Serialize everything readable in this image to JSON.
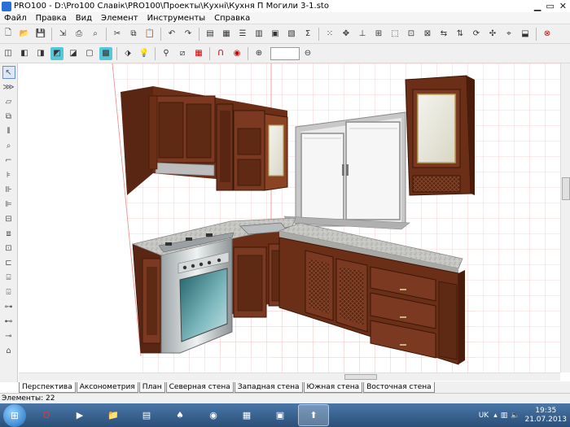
{
  "titlebar": {
    "title": "PRO100 - D:\\Pro100 Славік\\PRO100\\Проекты\\Кухні\\Кухня П Могили 3-1.sto",
    "minimize_icon": "minimize-icon",
    "maximize_icon": "maximize-icon",
    "close_icon": "close-icon"
  },
  "menu": {
    "file": "Файл",
    "edit": "Правка",
    "view": "Вид",
    "element": "Элемент",
    "tools": "Инструменты",
    "help": "Справка"
  },
  "toolbar_icons": [
    "new-icon",
    "open-icon",
    "save-icon",
    "export-icon",
    "print-icon",
    "print-preview-icon",
    "cut-icon",
    "copy-icon",
    "paste-icon",
    "undo-icon",
    "redo-icon",
    "library-icon",
    "report-icon",
    "list-icon",
    "table-icon",
    "price-icon",
    "sum-icon",
    "grid-icon",
    "move-icon",
    "rotate-icon"
  ],
  "zoom": {
    "value": ""
  },
  "tabs": [
    "Перспектива",
    "Аксонометрия",
    "План",
    "Северная стена",
    "Западная стена",
    "Южная стена",
    "Восточная стена"
  ],
  "status": {
    "elements": "Элементы: 22"
  },
  "tray": {
    "lang": "UK",
    "time": "19:35",
    "date": "21.07.2013"
  },
  "colors": {
    "wood": "#6b2f18",
    "wood_dark": "#4a1c0c",
    "countertop": "#c8c8c4",
    "grid": "#f2a5a5",
    "window_frame": "#9a9a9a"
  }
}
